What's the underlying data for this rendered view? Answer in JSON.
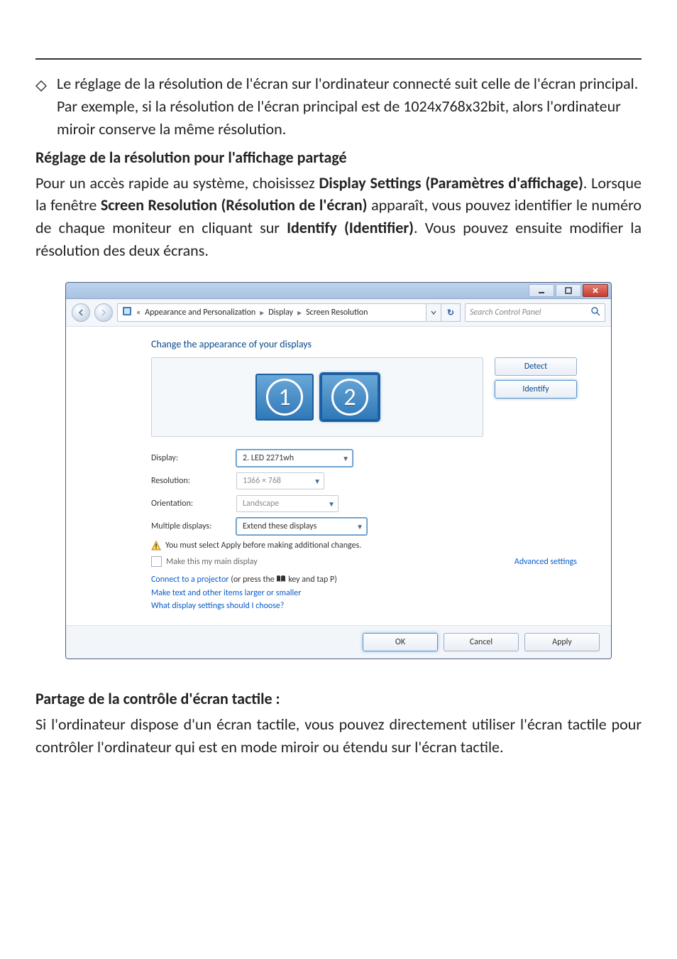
{
  "doc": {
    "bullet": "Le réglage de la résolution de l'écran sur l'ordinateur connecté suit celle de l'écran principal. Par exemple, si la résolution de l'écran principal est de 1024x768x32bit, alors l'ordinateur miroir conserve la même résolution.",
    "subheading": "Réglage de la résolution pour l'affichage partagé",
    "para_pre": "Pour un accès rapide au système, choisissez ",
    "para_bold1": "Display Settings (Paramètres d'affichage)",
    "para_mid1": ". Lorsque la fenêtre ",
    "para_bold2": "Screen Resolution (Résolution de l'écran)",
    "para_mid2": " apparaît, vous pouvez identifier le numéro de chaque moniteur en cliquant sur ",
    "para_bold3": "Identify (Identifier)",
    "para_tail": ". Vous pouvez ensuite modifier la résolution des deux écrans."
  },
  "shot": {
    "breadcrumb": {
      "seg0": "«",
      "seg1": "Appearance and Personalization",
      "seg2": "Display",
      "seg3": "Screen Resolution"
    },
    "search_placeholder": "Search Control Panel",
    "heading": "Change the appearance of your displays",
    "monitors": {
      "one": "1",
      "two": "2"
    },
    "buttons": {
      "detect": "Detect",
      "identify": "Identify",
      "ok": "OK",
      "cancel": "Cancel",
      "apply": "Apply"
    },
    "labels": {
      "display": "Display:",
      "resolution": "Resolution:",
      "orientation": "Orientation:",
      "multiple": "Multiple displays:"
    },
    "values": {
      "display": "2. LED 2271wh",
      "resolution": "1366 × 768",
      "orientation": "Landscape",
      "multiple": "Extend these displays"
    },
    "warning": "You must select Apply before making additional changes.",
    "main_display": "Make this my main display",
    "advanced": "Advanced settings",
    "links": {
      "projector_pre": "Connect to a projector",
      "projector_post": " (or press the ",
      "projector_tail": " key and tap P)",
      "text_size": "Make text and other items larger or smaller",
      "which": "What display settings should I choose?"
    }
  },
  "touch": {
    "heading": "Partage de la contrôle d'écran tactile :",
    "para": "Si l'ordinateur dispose d'un écran tactile, vous pouvez directement utiliser l'écran tactile pour contrôler l'ordinateur qui est en mode miroir ou étendu sur l'écran tactile."
  }
}
